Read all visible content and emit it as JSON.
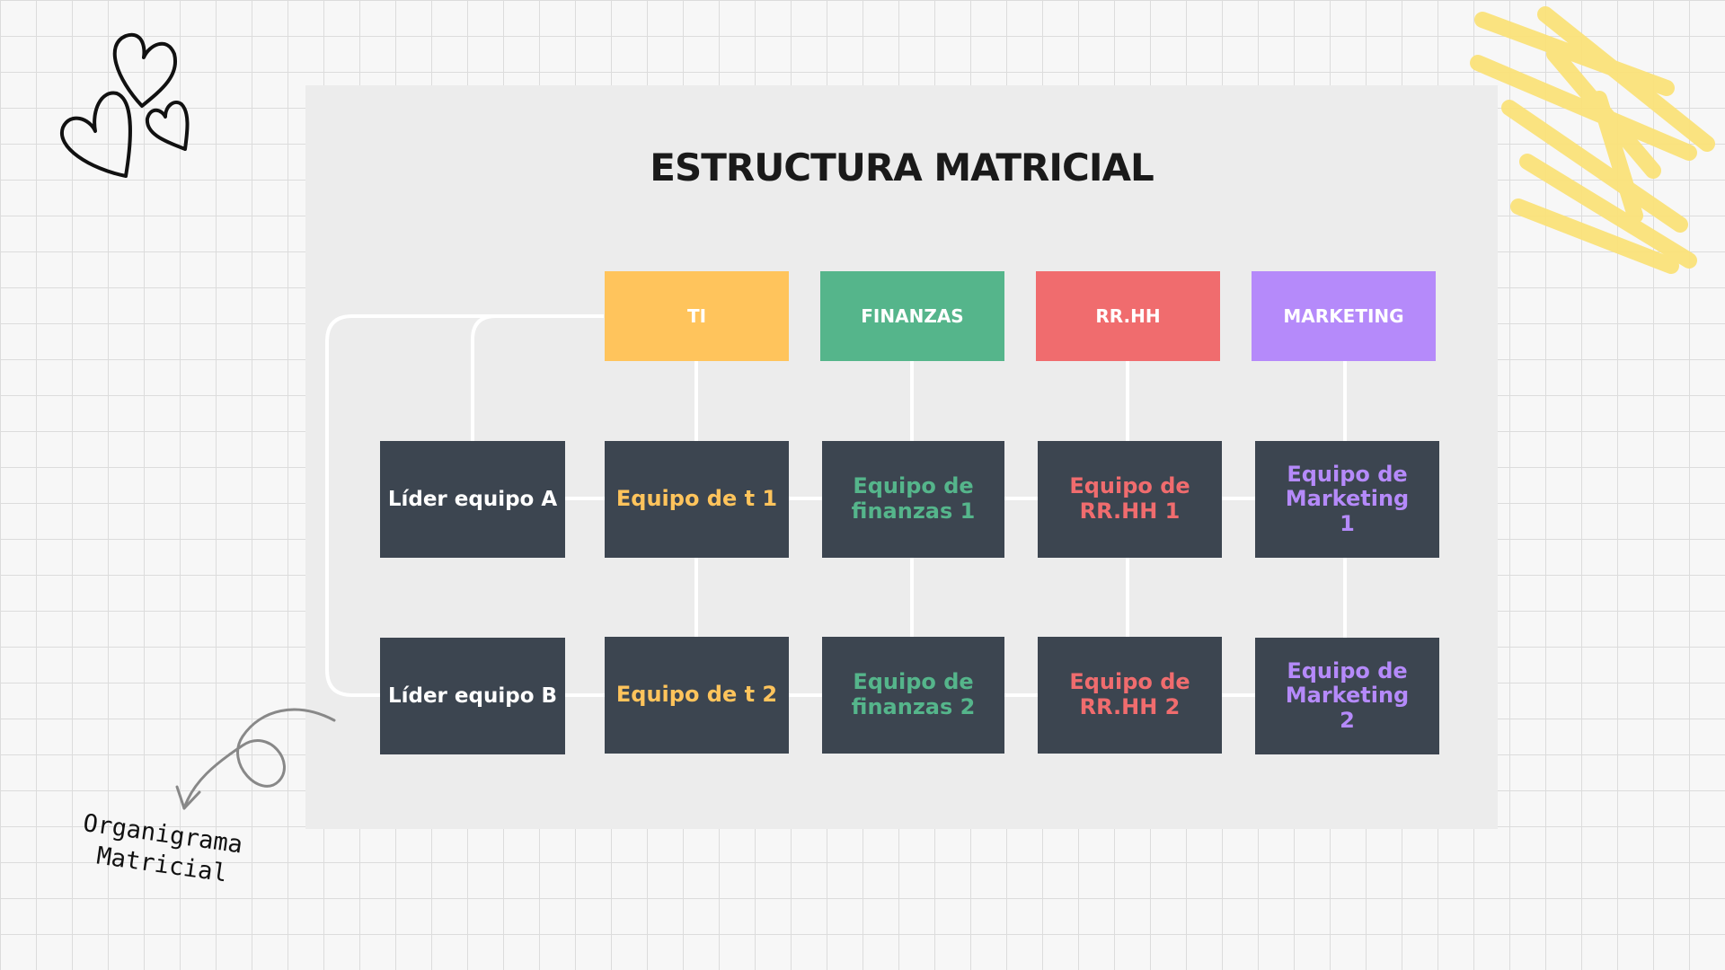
{
  "title": "ESTRUCTURA MATRICIAL",
  "caption": {
    "line1": "Organigrama",
    "line2": "Matricial"
  },
  "departments": [
    {
      "label": "TI",
      "color": "#ffc45c"
    },
    {
      "label": "FINANZAS",
      "color": "#55b58b"
    },
    {
      "label": "RR.HH",
      "color": "#f06c6e"
    },
    {
      "label": "MARKETING",
      "color": "#b58afa"
    }
  ],
  "leaders": [
    "Líder equipo A",
    "Líder equipo B"
  ],
  "teams": [
    [
      "Equipo de t 1",
      "Equipo de finanzas 1",
      "Equipo de RR.HH 1",
      "Equipo de Marketing 1"
    ],
    [
      "Equipo de t 2",
      "Equipo de finanzas 2",
      "Equipo de RR.HH 2",
      "Equipo de Marketing 2"
    ]
  ],
  "colors": {
    "box_dark": "#3c4550",
    "panel": "#ececec",
    "connector": "#ffffff",
    "scribble": "#fbe27a"
  }
}
